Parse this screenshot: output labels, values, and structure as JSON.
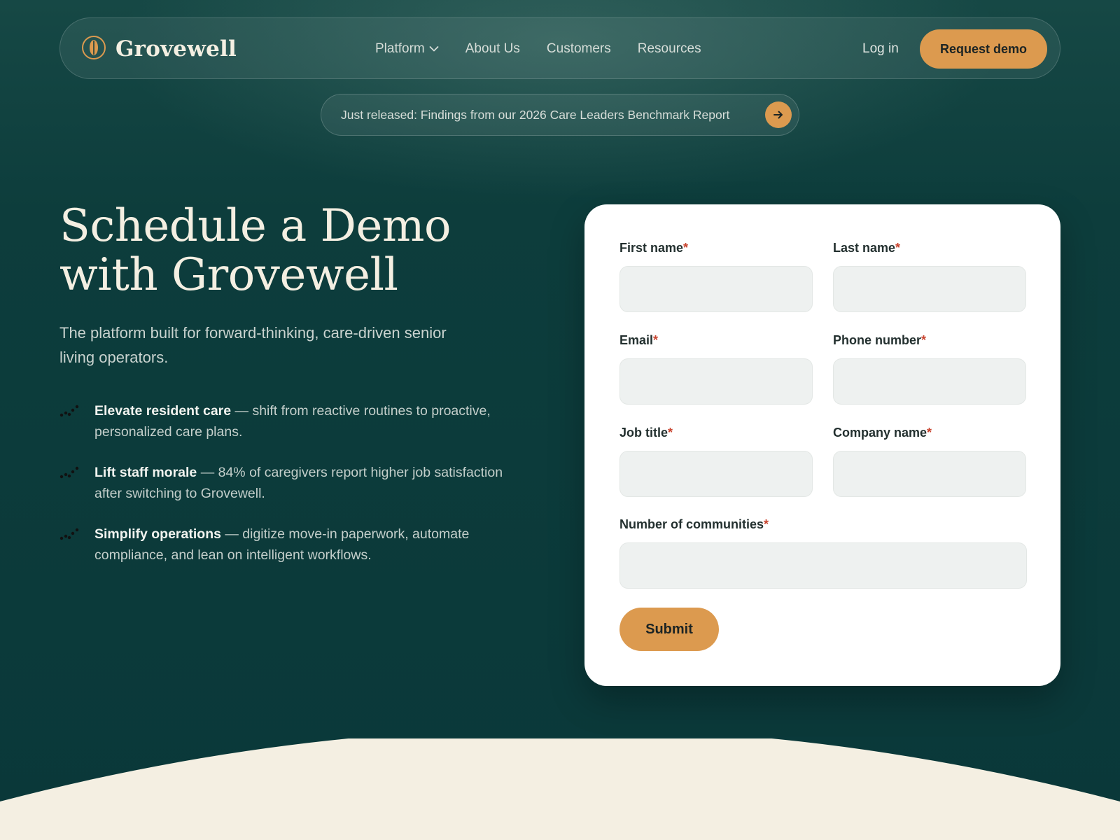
{
  "colors": {
    "background": "#0b3a3b",
    "accent": "#dc9a4f",
    "cream": "#f4efe2",
    "card": "#ffffff",
    "required": "#c9442f"
  },
  "nav": {
    "brand": "Grovewell",
    "brand_icon": "seed-logo-icon",
    "links": [
      {
        "label": "Platform",
        "has_dropdown": true
      },
      {
        "label": "About Us"
      },
      {
        "label": "Customers"
      },
      {
        "label": "Resources"
      }
    ],
    "login": "Log in",
    "cta": "Request demo"
  },
  "banner": {
    "text": "Just released: Findings from our 2026 Care Leaders Benchmark Report",
    "icon": "arrow-right-icon"
  },
  "hero": {
    "title_line1": "Schedule a Demo",
    "title_line2": "with Grovewell",
    "subtitle": "The platform built for forward-thinking, care-driven senior living operators.",
    "features": [
      {
        "title": "Elevate resident care",
        "text": " — shift from reactive routines to proactive, personalized care plans."
      },
      {
        "title": "Lift staff morale",
        "text": " — 84% of caregivers report higher job satisfaction after switching to Grovewell."
      },
      {
        "title": "Simplify operations",
        "text": " — digitize move-in paperwork, automate compliance, and lean on intelligent workflows."
      }
    ]
  },
  "form": {
    "fields": {
      "first_name": {
        "label": "First name",
        "required": "*",
        "value": ""
      },
      "last_name": {
        "label": "Last name",
        "required": "*",
        "value": ""
      },
      "email": {
        "label": "Email",
        "required": "*",
        "value": ""
      },
      "phone": {
        "label": "Phone number",
        "required": "*",
        "value": ""
      },
      "job_title": {
        "label": "Job title",
        "required": "*",
        "value": ""
      },
      "company": {
        "label": "Company name",
        "required": "*",
        "value": ""
      },
      "communities": {
        "label": "Number of communities",
        "required": "*",
        "value": ""
      }
    },
    "submit": "Submit"
  }
}
